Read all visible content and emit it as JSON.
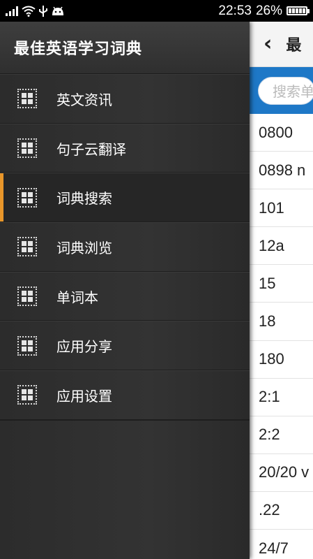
{
  "status_bar": {
    "time": "22:53",
    "battery": "26%",
    "icons": [
      "signal-icon",
      "wifi-icon",
      "usb-icon",
      "android-icon",
      "battery-icon"
    ]
  },
  "drawer": {
    "title": "最佳英语学习词典",
    "active_index": 2,
    "accent_color": "#e8962a",
    "items": [
      {
        "label": "英文资讯",
        "icon": "grid-icon"
      },
      {
        "label": "句子云翻译",
        "icon": "grid-icon"
      },
      {
        "label": "词典搜索",
        "icon": "grid-icon"
      },
      {
        "label": "词典浏览",
        "icon": "grid-icon"
      },
      {
        "label": "单词本",
        "icon": "grid-icon"
      },
      {
        "label": "应用分享",
        "icon": "grid-icon"
      },
      {
        "label": "应用设置",
        "icon": "grid-icon"
      }
    ]
  },
  "main": {
    "title_partial": "最",
    "search_placeholder_partial": "搜索单",
    "accent_color": "#1e78c7",
    "words": [
      "0800",
      "0898 n",
      "101",
      "12a",
      "15",
      "18",
      "180",
      "2:1",
      "2:2",
      "20/20 v",
      ".22",
      "24/7"
    ]
  }
}
